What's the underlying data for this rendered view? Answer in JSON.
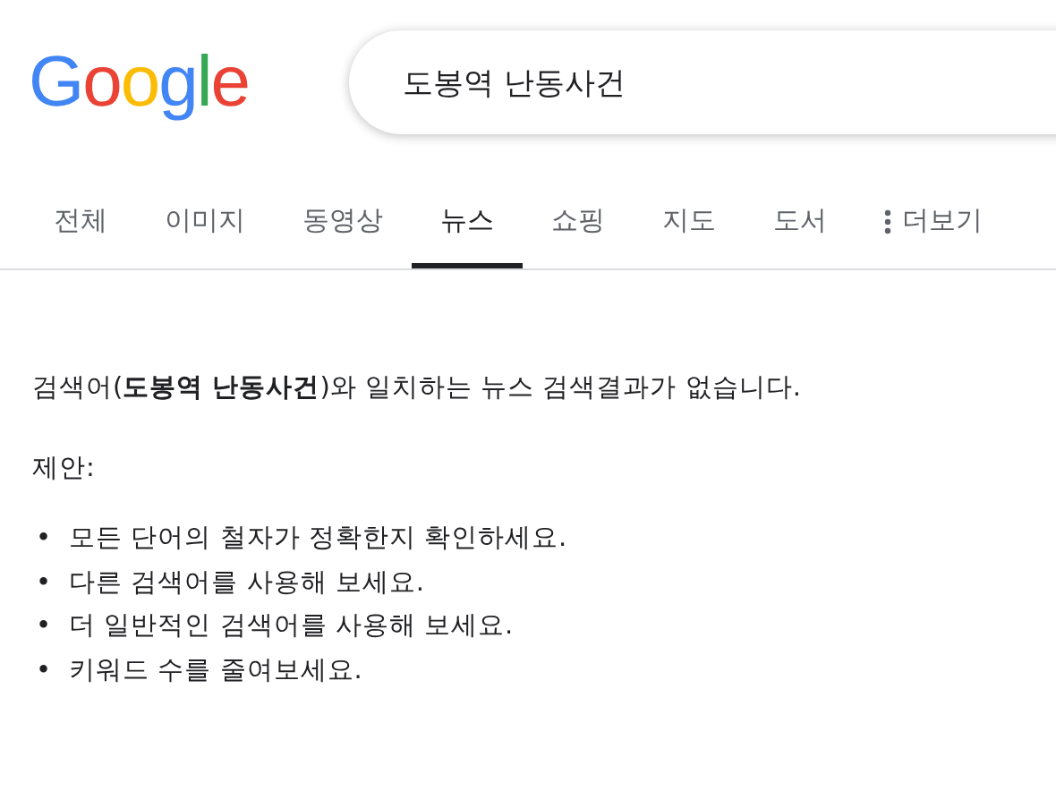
{
  "logo": "Google",
  "search": {
    "value": "도봉역 난동사건"
  },
  "tabs": [
    {
      "label": "전체",
      "selected": false
    },
    {
      "label": "이미지",
      "selected": false
    },
    {
      "label": "동영상",
      "selected": false
    },
    {
      "label": "뉴스",
      "selected": true
    },
    {
      "label": "쇼핑",
      "selected": false
    },
    {
      "label": "지도",
      "selected": false
    },
    {
      "label": "도서",
      "selected": false
    },
    {
      "label": "더보기",
      "selected": false,
      "kind": "more"
    }
  ],
  "message": "검색어(**도봉역 난동사건**)와 일치하는 뉴스 검색결과가 없습니다.",
  "suggestions_title": "제안:",
  "bullet": "•",
  "suggestions": [
    "모든 단어의 철자가 정확한지 확인하세요.",
    "다른 검색어를 사용해 보세요.",
    "더 일반적인 검색어를 사용해 보세요.",
    "키워드 수를 줄여보세요."
  ]
}
